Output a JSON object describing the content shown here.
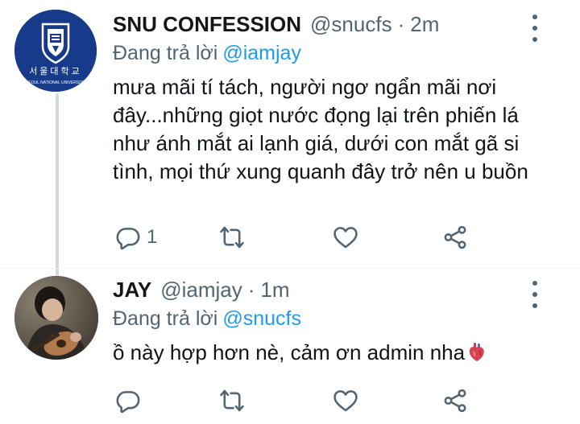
{
  "colors": {
    "text": "#0f1419",
    "secondary": "#536471",
    "link": "#1d9bf0",
    "snu_blue": "#173a8a"
  },
  "tweets": [
    {
      "avatar_icon": "snu-logo",
      "name": "SNU CONFESSION",
      "handle": "@snucfs",
      "separator": "·",
      "time": "2m",
      "reply_label": "Đang trả lời",
      "reply_to": "@iamjay",
      "text": "mưa mãi tí tách, người ngơ ngẩn mãi nơi đây...những giọt nước đọng lại trên phiến lá như ánh mắt ai lạnh giá, dưới con mắt gã si tình, mọi thứ xung quanh đây trở nên u buồn",
      "actions": {
        "reply_count": "1"
      },
      "logo": {
        "korean": "서울대학교",
        "english": "SEOUL NATIONAL UNIVERSITY"
      }
    },
    {
      "avatar_icon": "jay-photo",
      "name": "JAY",
      "handle": "@iamjay",
      "separator": "·",
      "time": "1m",
      "reply_label": "Đang trả lời",
      "reply_to": "@snucfs",
      "text": "ồ này hợp hơn nè, cảm ơn admin nha",
      "emoji": "anatomical-heart",
      "actions": {
        "reply_count": ""
      }
    }
  ]
}
